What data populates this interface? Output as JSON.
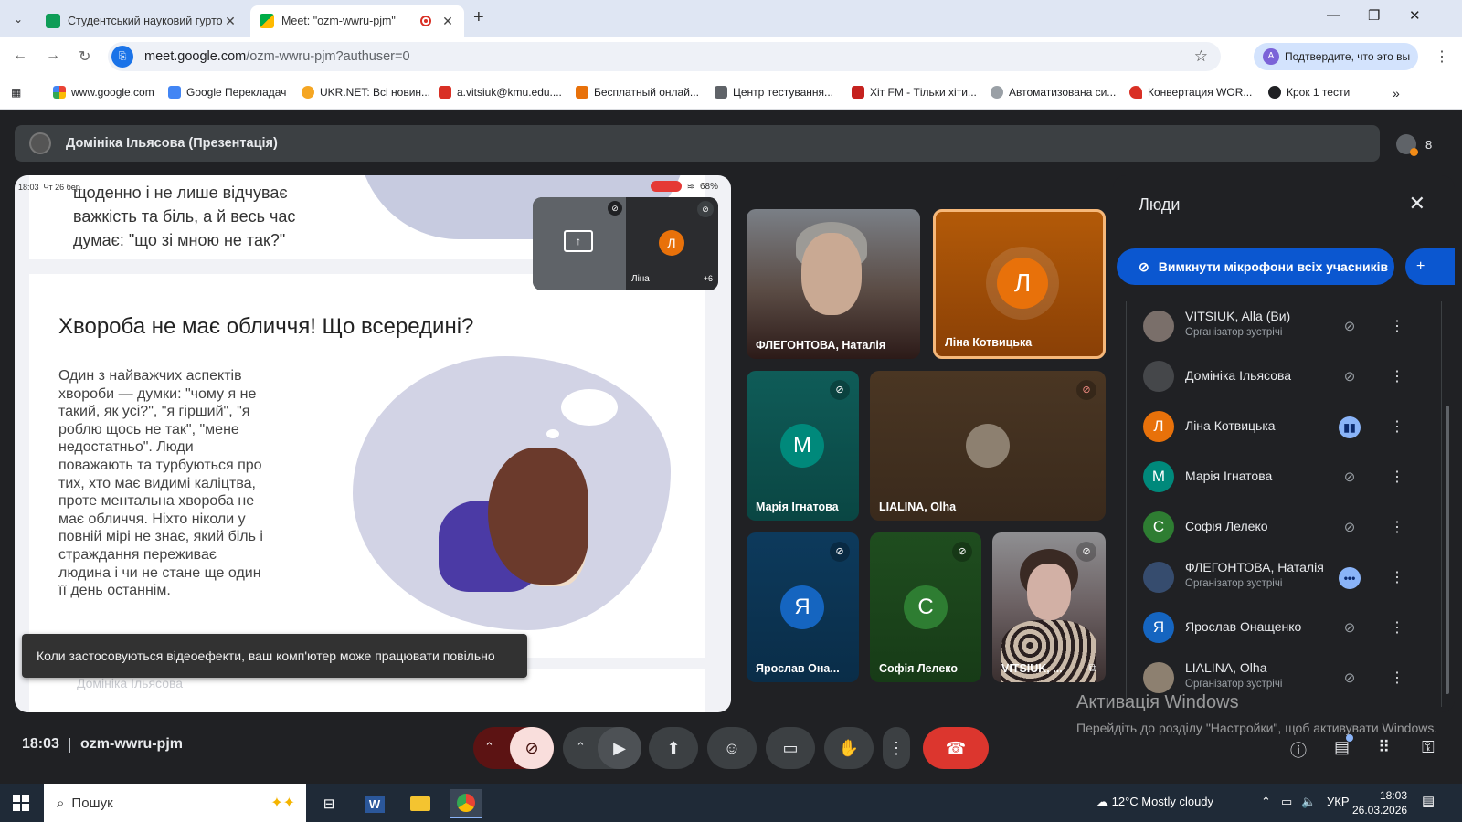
{
  "browser": {
    "tabs": [
      {
        "title": "Студентський науковий гурток"
      },
      {
        "title": "Meet: \"ozm-wwru-pjm\""
      }
    ],
    "url_main": "meet.google.com",
    "url_path": "/ozm-wwru-pjm?authuser=0",
    "profile_label": "Подтвердите, что это вы",
    "profile_initial": "A",
    "bookmarks": [
      "www.google.com",
      "Google Перекладач",
      "UKR.NET: Всі новин...",
      "a.vitsiuk@kmu.edu....",
      "Бесплатный онлай...",
      "Центр тестування...",
      "Хіт FM - Тільки хіти...",
      "Автоматизована си...",
      "Конвертация WOR...",
      "Крок 1 тести"
    ]
  },
  "meet": {
    "presenter_title": "Домініка Ільясова (Презентація)",
    "participant_count": "8",
    "presentation": {
      "status_time": "18:03",
      "status_date": "Чт 26 бер.",
      "battery": "68%",
      "top_text": "щоденно і не лише відчуває важкість та біль, а й весь час думає: \"що зі мною не так?\"",
      "heading": "Хвороба не має обличчя! Що всередині?",
      "body": "Один з найважчих аспектів хвороби — думки: \"чому я не такий, як усі?\", \"я гірший\", \"я роблю щось не так\", \"мене недостатньо\". Люди поважають та турбуються про тих, хто має видимі каліцтва, проте ментальна хвороба не має обличчя. Ніхто ніколи у повній мірі не знає, який біль і страждання переживає людина і чи не стане ще один її день останнім.",
      "presenter_footer": "Домініка Ільясова"
    },
    "selfview": {
      "name": "Ліна",
      "initial": "Л",
      "more": "+6"
    },
    "toast": "Коли застосовуються відеоефекти, ваш комп'ютер може працювати повільно",
    "tiles": [
      {
        "name": "ФЛЕГОНТОВА, Наталія"
      },
      {
        "name": "Ліна Котвицька",
        "initial": "Л"
      },
      {
        "name": "Марія Ігнатова",
        "initial": "М"
      },
      {
        "name": "LIALINA, Olha"
      },
      {
        "name": "Ярослав Она...",
        "initial": "Я"
      },
      {
        "name": "Софія Лелеко",
        "initial": "С"
      },
      {
        "name": "VITSIUK, ..."
      }
    ],
    "people_panel": {
      "title": "Люди",
      "mute_all": "Вимкнути мікрофони всіх учасників",
      "people": [
        {
          "name": "VITSIUK, Alla (Ви)",
          "role": "Організатор зустрічі"
        },
        {
          "name": "Домініка Ільясова"
        },
        {
          "name": "Ліна Котвицька",
          "initial": "Л"
        },
        {
          "name": "Марія Ігнатова",
          "initial": "М"
        },
        {
          "name": "Софія Лелеко",
          "initial": "С"
        },
        {
          "name": "ФЛЕГОНТОВА, Наталія",
          "role": "Організатор зустрічі"
        },
        {
          "name": "Ярослав Онащенко",
          "initial": "Я"
        },
        {
          "name": "LIALINA, Olha",
          "role": "Організатор зустрічі"
        }
      ]
    },
    "clock": "18:03",
    "meeting_code": "ozm-wwru-pjm"
  },
  "activation": {
    "title": "Активація Windows",
    "text": "Перейдіть до розділу \"Настройки\", щоб активувати Windows."
  },
  "taskbar": {
    "search": "Пошук",
    "weather": "12°C  Mostly cloudy",
    "lang": "УКР",
    "time": "18:03",
    "date": "26.03.2026"
  },
  "colors": {
    "accent_blue": "#0b57d0",
    "orange_avatar": "#e8710a",
    "teal_tile": "#0f5c58",
    "end_call": "#dc362e"
  }
}
